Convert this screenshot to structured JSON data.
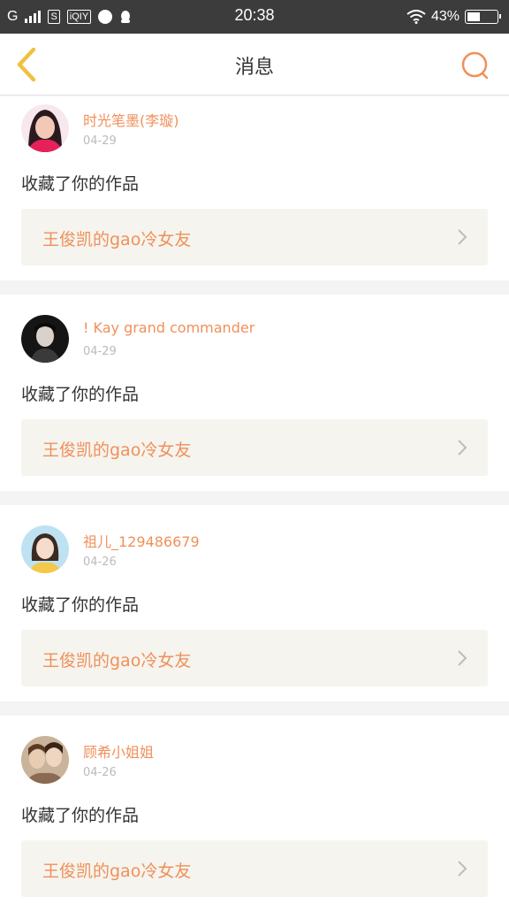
{
  "status_bar": {
    "carrier": "G",
    "time": "20:38",
    "battery": "43%",
    "battery_level": 0.43,
    "app_icons": [
      "s-box-icon",
      "iqiyi-icon",
      "alarm-icon",
      "qq-icon"
    ],
    "iqiyi_label": "iQIY"
  },
  "nav": {
    "title": "消息",
    "back_icon": "chevron-left-icon",
    "search_icon": "search-icon",
    "accent_color": "#f0905a",
    "back_color": "#f0c040"
  },
  "messages": [
    {
      "username": "时光笔墨(李璇)",
      "date": "04-29",
      "action": "收藏了你的作品",
      "work_title": "王俊凯的gao冷女友",
      "avatar": "girl-red-portrait"
    },
    {
      "username": "! Kay grand commander",
      "date": "04-29",
      "action": "收藏了你的作品",
      "work_title": "王俊凯的gao冷女友",
      "avatar": "dark-portrait"
    },
    {
      "username": "祖儿_129486679",
      "date": "04-26",
      "action": "收藏了你的作品",
      "work_title": "王俊凯的gao冷女友",
      "avatar": "girl-yellow-portrait"
    },
    {
      "username": "顾希小姐姐",
      "date": "04-26",
      "action": "收藏了你的作品",
      "work_title": "王俊凯的gao冷女友",
      "avatar": "two-people-portrait"
    }
  ]
}
